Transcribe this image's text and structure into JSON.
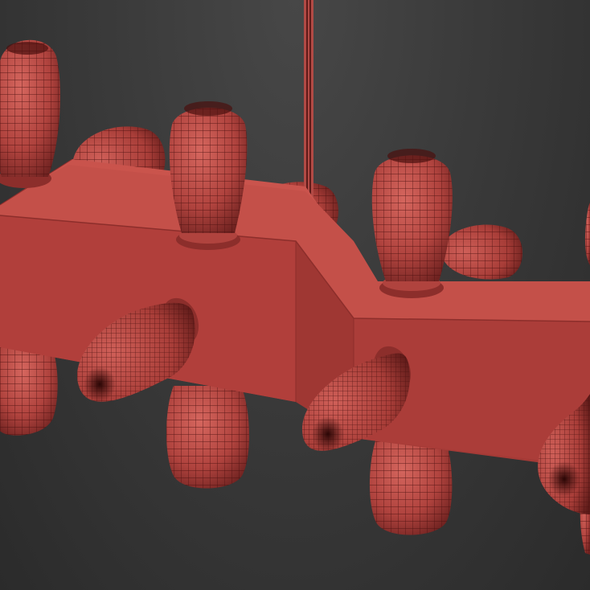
{
  "viewport": {
    "background": "#3a3a3a",
    "background_dark": "#2b2b2b"
  },
  "model": {
    "object": "wireframe-lamp-fixture",
    "material_color": "#b24a45",
    "material_highlight": "#d96a62",
    "material_shadow": "#6e2220",
    "wire_color": "#4a0f0e",
    "bulb_count": 13
  }
}
